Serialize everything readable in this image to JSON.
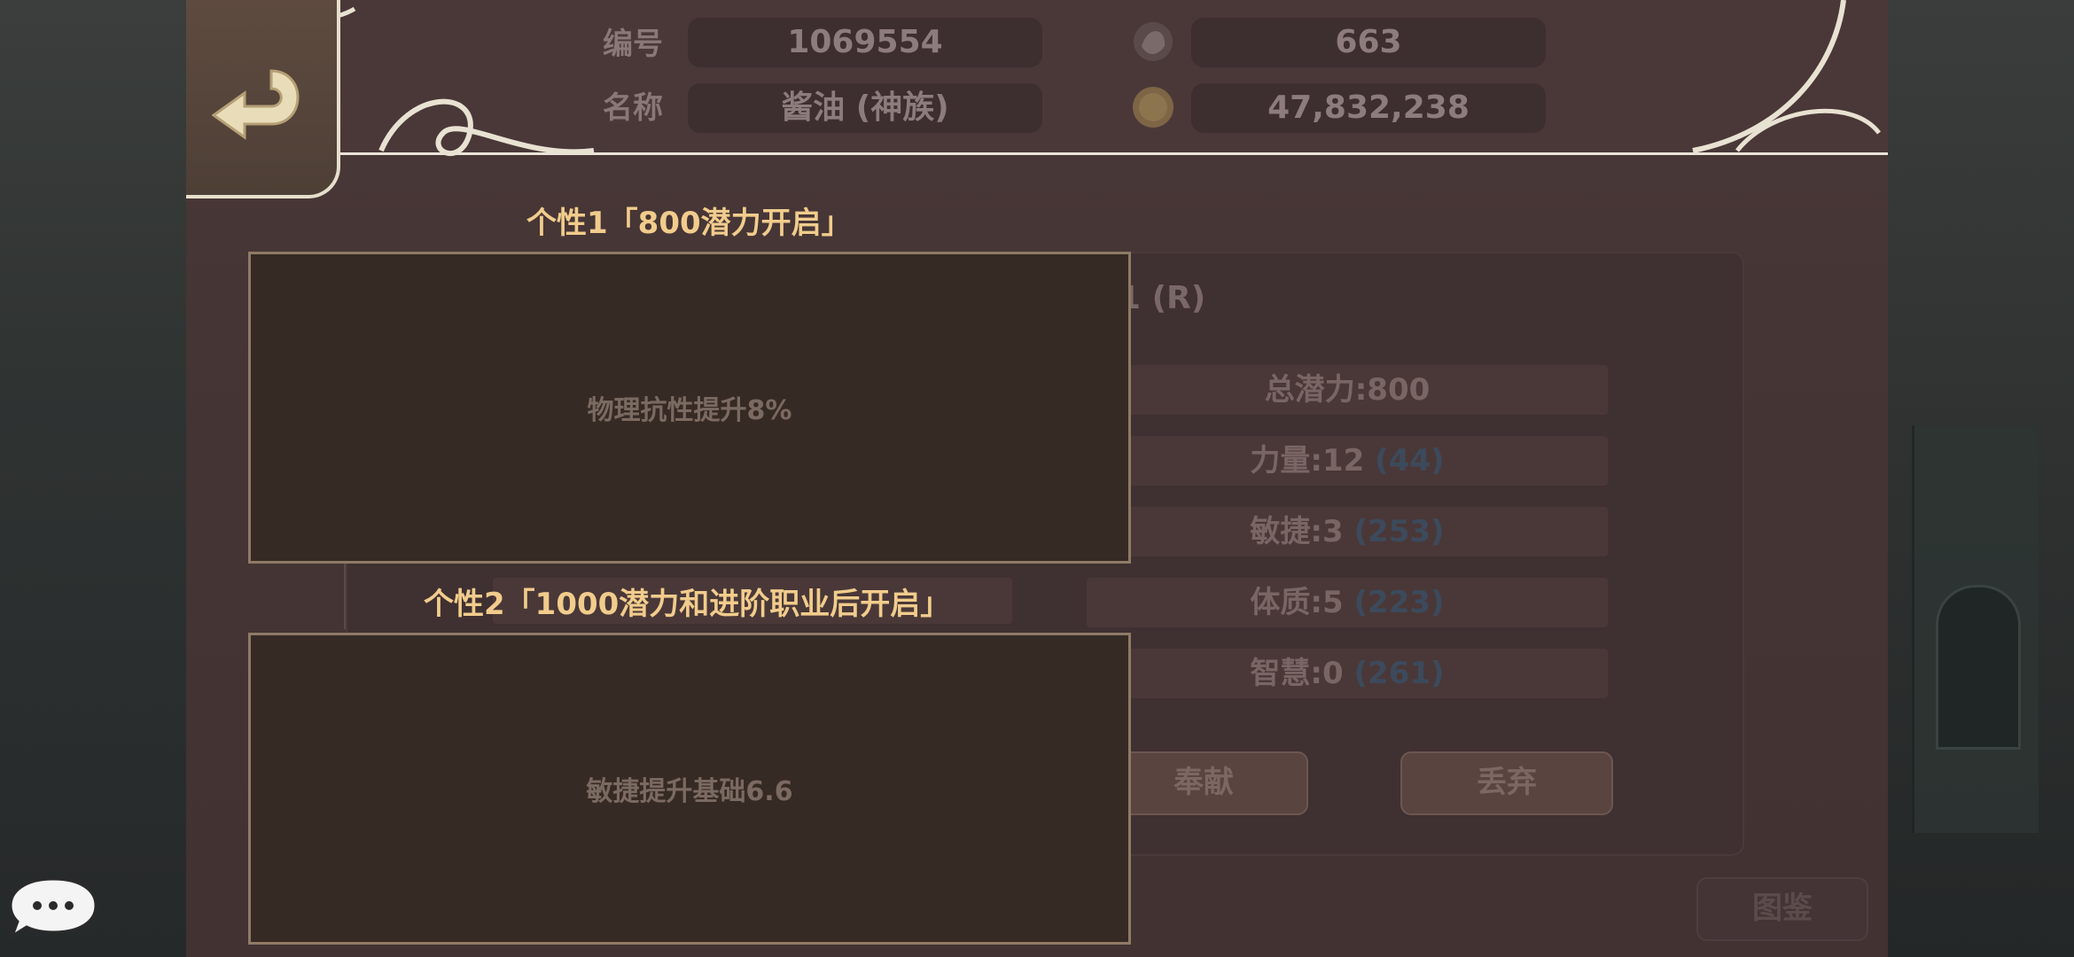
{
  "header": {
    "id_label": "编号",
    "id_value": "1069554",
    "name_label": "名称",
    "name_value": "酱油 (神族)",
    "gem_count": "663",
    "gold_count": "47,832,238"
  },
  "card": {
    "title_fragment": "1 (R)",
    "stats": [
      {
        "label": "总潜力:800",
        "extra": ""
      },
      {
        "label": "力量:12",
        "extra": "(44)"
      },
      {
        "label": "敏捷:3",
        "extra": "(253)"
      },
      {
        "label": "体质:5",
        "extra": "(223)"
      },
      {
        "label": "智慧:0",
        "extra": "(261)"
      }
    ],
    "donate_label": "奉献",
    "discard_label": "丢弃",
    "gallery_label": "图鉴"
  },
  "traits": [
    {
      "title": "个性1「800潜力开启」",
      "text": "物理抗性提升8%"
    },
    {
      "title": "个性2「1000潜力和进阶职业后开启」",
      "text": "敏捷提升基础6.6"
    }
  ],
  "icons": {
    "back": "back-arrow-icon",
    "gem": "gem-icon",
    "gold": "gold-coin-icon",
    "chat": "chat-bubble-icon"
  },
  "colors": {
    "trait_title": "#f1cc8c",
    "panel": "#463535",
    "trait_box": "#362a24"
  }
}
